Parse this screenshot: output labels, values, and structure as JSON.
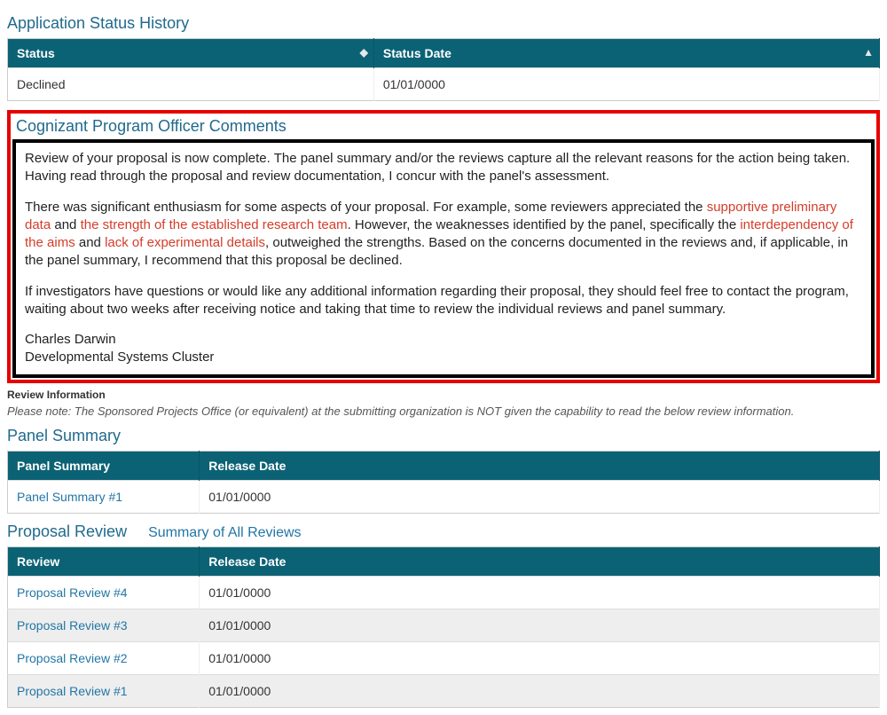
{
  "statusHistory": {
    "title": "Application Status History",
    "headers": {
      "status": "Status",
      "statusDate": "Status Date"
    },
    "rows": [
      {
        "status": "Declined",
        "statusDate": "01/01/0000"
      }
    ]
  },
  "comments": {
    "title": "Cognizant Program Officer Comments",
    "para1_a": "Review of your proposal is now complete. The panel summary and/or the reviews capture all the relevant reasons for the action being taken. Having read through the proposal and review documentation, I concur with the panel's assessment.",
    "para2_a": "There was significant enthusiasm for some aspects of your proposal.  For example, some reviewers appreciated the ",
    "para2_r1": "supportive preliminary data",
    "para2_b": " and ",
    "para2_r2": "the strength of the established research team",
    "para2_c": ".  However, the weaknesses identified by the panel, specifically the ",
    "para2_r3": "interdependency of the aims",
    "para2_d": " and ",
    "para2_r4": "lack of experimental details",
    "para2_e": ", outweighed the strengths. Based on the concerns documented in the reviews and, if applicable, in the panel summary, I recommend that this proposal be declined.",
    "para3": "If investigators have questions or would like any additional information regarding their proposal, they should feel free to contact the program, waiting about two weeks after receiving notice and taking that time to review the individual reviews and panel summary.",
    "sig_name": "Charles Darwin",
    "sig_cluster": "Developmental Systems Cluster"
  },
  "reviewInfo": {
    "heading": "Review Information",
    "note": "Please note: The Sponsored Projects Office (or equivalent) at the submitting organization is NOT given the capability to read the below review information."
  },
  "panelSummary": {
    "title": "Panel Summary",
    "headers": {
      "panel": "Panel Summary",
      "releaseDate": "Release Date"
    },
    "rows": [
      {
        "label": "Panel Summary #1",
        "date": "01/01/0000"
      }
    ]
  },
  "proposalReview": {
    "title": "Proposal Review",
    "summaryLink": "Summary of All Reviews",
    "headers": {
      "review": "Review",
      "releaseDate": "Release Date"
    },
    "rows": [
      {
        "label": "Proposal Review #4",
        "date": "01/01/0000"
      },
      {
        "label": "Proposal Review #3",
        "date": "01/01/0000"
      },
      {
        "label": "Proposal Review #2",
        "date": "01/01/0000"
      },
      {
        "label": "Proposal Review #1",
        "date": "01/01/0000"
      }
    ]
  }
}
